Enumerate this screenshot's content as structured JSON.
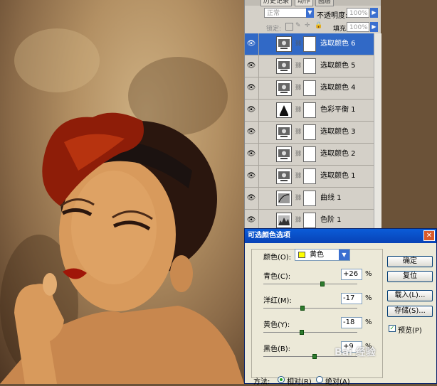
{
  "panel_tabs": [
    "历史记录",
    "动作",
    "图层"
  ],
  "layers_panel": {
    "blend_mode": "正常",
    "opacity_label": "不透明度:",
    "opacity_value": "100%",
    "lock_label": "锁定:",
    "fill_label": "填充:",
    "fill_value": "100%",
    "layers": [
      {
        "name": "选取颜色 6",
        "selected": true,
        "icon": "selective-color-icon"
      },
      {
        "name": "选取颜色 5",
        "selected": false,
        "icon": "selective-color-icon"
      },
      {
        "name": "选取颜色 4",
        "selected": false,
        "icon": "selective-color-icon"
      },
      {
        "name": "色彩平衡 1",
        "selected": false,
        "icon": "color-balance-icon"
      },
      {
        "name": "选取颜色 3",
        "selected": false,
        "icon": "selective-color-icon"
      },
      {
        "name": "选取颜色 2",
        "selected": false,
        "icon": "selective-color-icon"
      },
      {
        "name": "选取颜色 1",
        "selected": false,
        "icon": "selective-color-icon"
      },
      {
        "name": "曲线 1",
        "selected": false,
        "icon": "curves-icon"
      },
      {
        "name": "色阶 1",
        "selected": false,
        "icon": "levels-icon"
      }
    ]
  },
  "dialog": {
    "title": "可选颜色选项",
    "colors_label": "颜色(O):",
    "colors_value": "黄色",
    "colors_swatch": "#ffff00",
    "fields": [
      {
        "label": "青色(C):",
        "value": "+26",
        "unit": "%",
        "level": 0.63
      },
      {
        "label": "洋红(M):",
        "value": "-17",
        "unit": "%",
        "level": 0.415
      },
      {
        "label": "黄色(Y):",
        "value": "-18",
        "unit": "%",
        "level": 0.41
      },
      {
        "label": "黑色(B):",
        "value": "+9",
        "unit": "%",
        "level": 0.545
      }
    ],
    "buttons": {
      "ok": "确定",
      "reset": "复位",
      "load": "载入(L)...",
      "save": "存储(S)..."
    },
    "preview_label": "预览(P)",
    "method_label": "方法:",
    "relative_label": "相对(R)",
    "absolute_label": "绝对(A)"
  },
  "watermark": "Bai 经验",
  "colors": {
    "selection": "#3169c6",
    "title_bar": "#0842b6"
  }
}
